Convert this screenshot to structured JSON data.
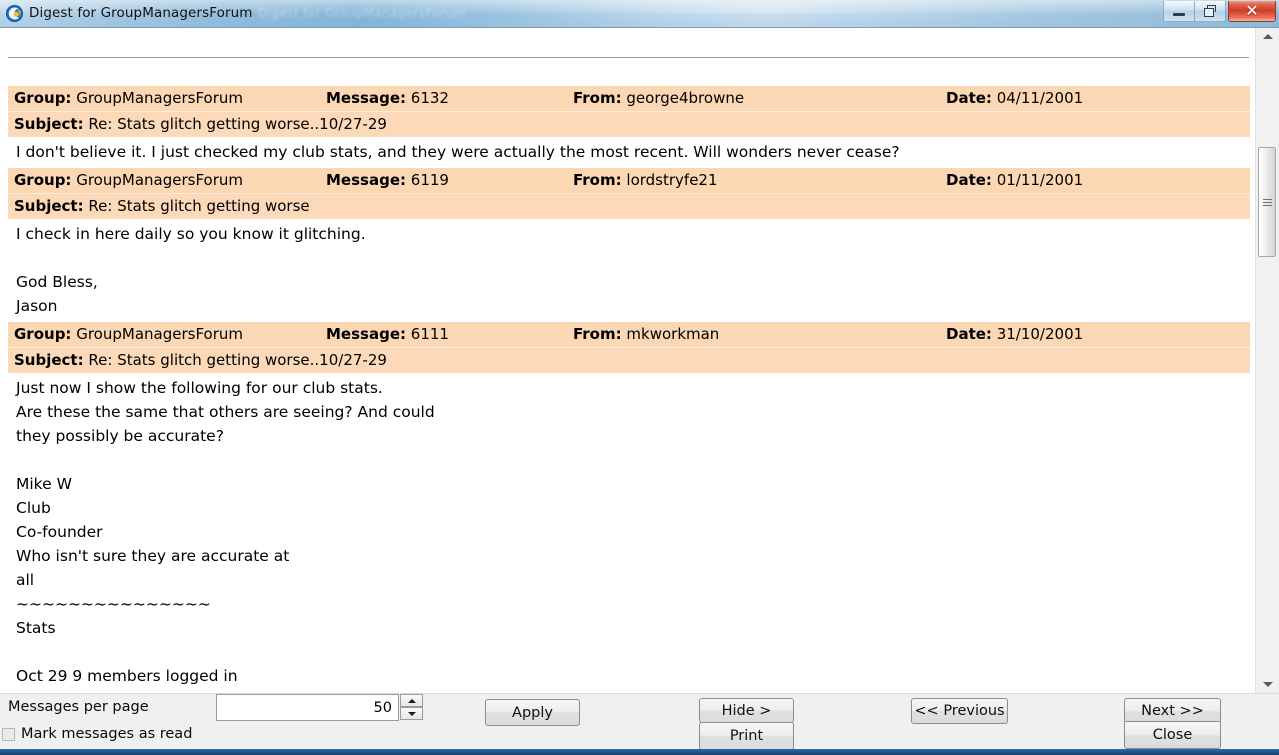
{
  "window": {
    "title": "Digest for GroupManagersForum",
    "ghost_title": "Digest for GroupManagersForum",
    "icon": "groups-swirl-icon",
    "controls": {
      "minimize": "minimize-icon",
      "restore": "restore-icon",
      "close": "close-icon"
    }
  },
  "colors": {
    "header_band": "#fbd7b4",
    "subject_band": "#fcd9b8",
    "title_accent": "#7fb0d4",
    "close_button": "#cd3c24"
  },
  "labels": {
    "group": "Group:",
    "message": "Message:",
    "from": "From:",
    "date": "Date:",
    "subject": "Subject:"
  },
  "messages": [
    {
      "group": "GroupManagersForum",
      "message_id": "6132",
      "from": "george4browne",
      "date": "04/11/2001",
      "subject": "Re: Stats glitch getting worse..10/27-29",
      "body": "I don't believe it. I just checked my club stats, and they were actually the most recent. Will wonders never cease?"
    },
    {
      "group": "GroupManagersForum",
      "message_id": "6119",
      "from": "lordstryfe21",
      "date": "01/11/2001",
      "subject": "Re: Stats glitch getting worse",
      "body": "I check in here daily so you know it glitching.\n\nGod Bless,\nJason"
    },
    {
      "group": "GroupManagersForum",
      "message_id": "6111",
      "from": "mkworkman",
      "date": "31/10/2001",
      "subject": "Re: Stats glitch getting worse..10/27-29",
      "body": "Just now I show the following for our club stats.\nAre these the same that others are seeing? And could\nthey possibly be accurate?\n\nMike W\nClub\nCo-founder\nWho isn't sure they are accurate at\nall\n~~~~~~~~~~~~~~~\nStats\n\nOct 29 9 members logged in"
    }
  ],
  "scrollbar": {
    "up_arrow": "scroll-up-icon",
    "down_arrow": "scroll-down-icon"
  },
  "bottom_bar": {
    "messages_per_page_label": "Messages per page",
    "messages_per_page_value": "50",
    "spinner_up": "spinner-up-icon",
    "spinner_down": "spinner-down-icon",
    "mark_as_read_label": "Mark messages as read",
    "mark_as_read_checked": false,
    "buttons": {
      "apply": "Apply",
      "hide": "Hide >",
      "print": "Print",
      "previous": "<< Previous",
      "next": "Next >>",
      "close": "Close"
    }
  }
}
